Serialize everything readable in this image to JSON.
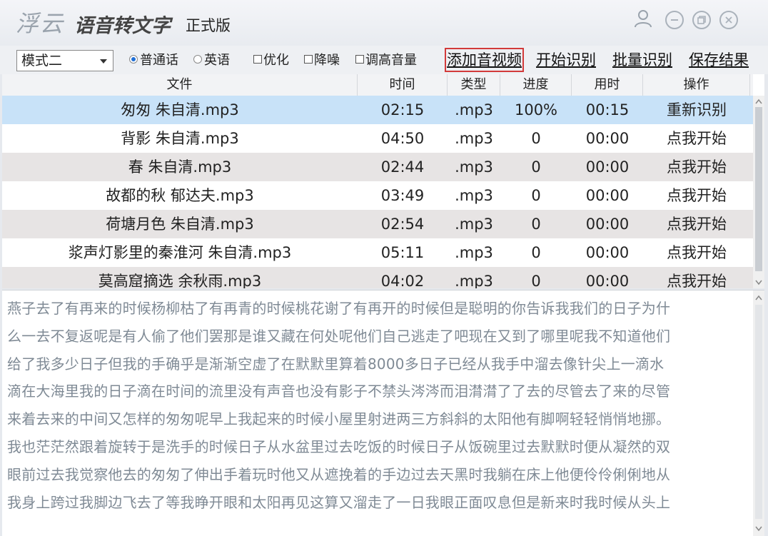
{
  "titlebar": {
    "logo": "浮云",
    "app_title": "语音转文字",
    "edition": "正式版"
  },
  "toolbar": {
    "mode_value": "模式二",
    "language_options": [
      "普通话",
      "英语"
    ],
    "language_selected": "普通话",
    "checkbox_options": [
      "优化",
      "降噪",
      "调高音量"
    ],
    "links": [
      "添加音视频",
      "开始识别",
      "批量识别",
      "保存结果"
    ],
    "highlighted_link": "添加音视频"
  },
  "table": {
    "columns": [
      "文件",
      "时间",
      "类型",
      "进度",
      "用时",
      "操作"
    ],
    "rows": [
      {
        "file": "匆匆 朱自清.mp3",
        "time": "02:15",
        "type": ".mp3",
        "progress": "100%",
        "elapsed": "00:15",
        "action": "重新识别"
      },
      {
        "file": "背影 朱自清.mp3",
        "time": "04:50",
        "type": ".mp3",
        "progress": "0",
        "elapsed": "00:00",
        "action": "点我开始"
      },
      {
        "file": "春 朱自清.mp3",
        "time": "02:44",
        "type": ".mp3",
        "progress": "0",
        "elapsed": "00:00",
        "action": "点我开始"
      },
      {
        "file": "故都的秋 郁达夫.mp3",
        "time": "03:49",
        "type": ".mp3",
        "progress": "0",
        "elapsed": "00:00",
        "action": "点我开始"
      },
      {
        "file": "荷塘月色 朱自清.mp3",
        "time": "02:54",
        "type": ".mp3",
        "progress": "0",
        "elapsed": "00:00",
        "action": "点我开始"
      },
      {
        "file": "浆声灯影里的秦淮河  朱自清.mp3",
        "time": "05:11",
        "type": ".mp3",
        "progress": "0",
        "elapsed": "00:00",
        "action": "点我开始"
      },
      {
        "file": "莫高窟摘选  余秋雨.mp3",
        "time": "04:02",
        "type": ".mp3",
        "progress": "0",
        "elapsed": "00:00",
        "action": "点我开始"
      }
    ]
  },
  "result_text": {
    "lines": [
      "燕子去了有再来的时候杨柳枯了有再青的时候桃花谢了有再开的时候但是聪明的你告诉我我们的日子为什",
      "么一去不复返呢是有人偷了他们罢那是谁又藏在何处呢他们自己逃走了吧现在又到了哪里呢我不知道他们",
      "给了我多少日子但我的手确乎是渐渐空虚了在默默里算着8000多日子已经从我手中溜去像针尖上一滴水",
      "滴在大海里我的日子滴在时间的流里没有声音也没有影子不禁头涔涔而泪潸潸了了去的尽管去了来的尽管",
      "来着去来的中间又怎样的匆匆呢早上我起来的时候小屋里射进两三方斜斜的太阳他有脚啊轻轻悄悄地挪。",
      "我也茫茫然跟着旋转于是洗手的时候日子从水盆里过去吃饭的时候日子从饭碗里过去默默时便从凝然的双",
      "眼前过去我觉察他去的匆匆了伸出手着玩时他又从遮挽着的手边过去天黑时我躺在床上他便伶伶俐俐地从",
      "我身上跨过我脚边飞去了等我睁开眼和太阳再见这算又溜走了一日我眼正面叹息但是新来时我时候从头上"
    ]
  },
  "colors": {
    "selected_row": "#c8e2f8",
    "alt_row": "#e7e4e4",
    "highlight_border": "#d23a3a",
    "radio_accent": "#1f6fd6"
  },
  "icons": [
    "user-icon",
    "minimize-icon",
    "restore-icon",
    "close-icon",
    "dropdown-arrow-icon",
    "scroll-up-icon",
    "scroll-down-icon"
  ]
}
